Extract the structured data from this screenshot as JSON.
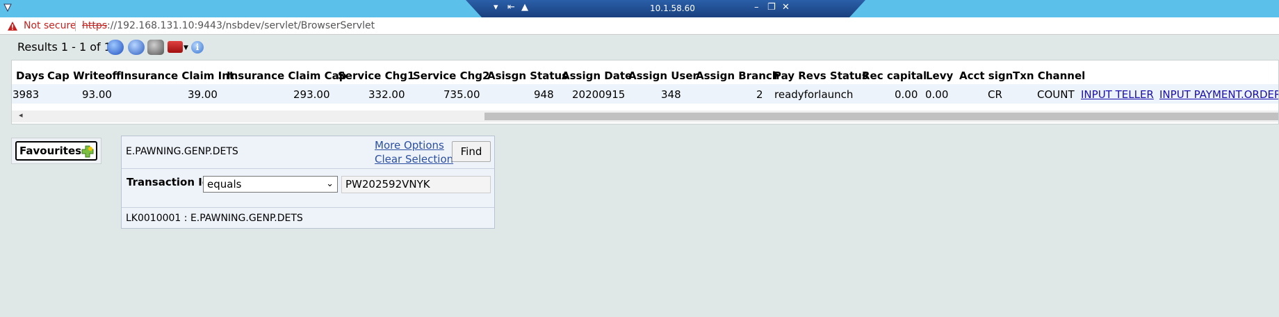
{
  "remote_bar": {
    "title": "10.1.58.60",
    "controls": [
      "▾",
      "⇤",
      "▲",
      "–",
      "❐",
      "✕"
    ]
  },
  "address_bar": {
    "security_label": "Not secure",
    "url_scheme": "https",
    "url_rest": "://192.168.131.10:9443/nsbdev/servlet/BrowserServlet"
  },
  "toolbar": {
    "results_label": "Results 1 - 1 of 1",
    "info_label": "i"
  },
  "grid": {
    "columns": [
      "Days",
      "Cap Writeoff",
      "Insurance Claim Int",
      "Insurance Claim Cap",
      "Service Chg1",
      "Service Chg2",
      "Asisgn Status",
      "Assign Date",
      "Assign User",
      "Assign Branch",
      "Pay Revs Status",
      "Rec capital",
      "Levy",
      "Acct sign",
      "Txn Channel"
    ],
    "row": [
      "3983",
      "93.00",
      "39.00",
      "293.00",
      "332.00",
      "735.00",
      "948",
      "20200915",
      "348",
      "2",
      "readyforlaunch",
      "0.00",
      "0.00",
      "CR",
      "COUNT",
      "INPUT TELLER",
      "INPUT PAYMENT.ORDER"
    ],
    "scroll_left": "◂"
  },
  "favourites": {
    "label": "Favourites"
  },
  "selection": {
    "enquiry_name": "E.PAWNING.GENP.DETS",
    "more_options": "More Options",
    "clear_selection": "Clear Selection",
    "find_label": "Find",
    "field_label": "Transaction Id",
    "operator": "equals",
    "value": "PW202592VNYK",
    "footer": "LK0010001 : E.PAWNING.GENP.DETS"
  }
}
